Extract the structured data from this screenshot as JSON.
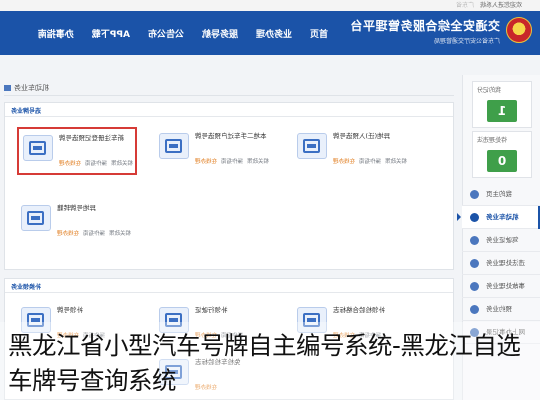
{
  "topbar": {
    "text": "欢迎您进入系统",
    "region": "广东省"
  },
  "header": {
    "brand_title": "交通安全综合服务管理平台",
    "brand_sub": "广东省公安厅交通管理局",
    "nav": [
      "首页",
      "业务办理",
      "服务导航",
      "公告公布",
      "APP下载",
      "办事指南"
    ]
  },
  "sidebar": {
    "cards": [
      {
        "label": "我的记分",
        "value": "1"
      },
      {
        "label": "待处理违法",
        "value": "0"
      }
    ],
    "menu": [
      {
        "label": "我的主页",
        "active": false
      },
      {
        "label": "机动车业务",
        "active": true
      },
      {
        "label": "驾驶证业务",
        "active": false
      },
      {
        "label": "违法处理业务",
        "active": false
      },
      {
        "label": "事故处理业务",
        "active": false
      },
      {
        "label": "预约业务",
        "active": false
      },
      {
        "label": "网上办事记录",
        "active": false
      }
    ]
  },
  "breadcrumb": {
    "label": "机动车业务"
  },
  "panels": [
    {
      "title": "选号牌业务",
      "services": [
        {
          "title": "新车注册登记预选号牌",
          "actions": [
            "在线办理",
            "操作指南",
            "相关政策"
          ],
          "highlight": true
        },
        {
          "title": "本地二手车过户预选号牌",
          "actions": [
            "在线办理",
            "操作指南",
            "相关政策"
          ],
          "highlight": false
        },
        {
          "title": "异地(迁)入预选号牌",
          "actions": [
            "在线办理",
            "操作指南",
            "相关政策"
          ],
          "highlight": false
        },
        {
          "title": "异地号牌转籍",
          "actions": [
            "在线办理",
            "操作指南",
            "相关政策"
          ],
          "highlight": false
        }
      ]
    },
    {
      "title": "补换领业务",
      "services": [
        {
          "title": "补领号牌",
          "actions": [
            "在线办理",
            "操作指南"
          ],
          "highlight": false
        },
        {
          "title": "补领行驶证",
          "actions": [
            "在线办理",
            "操作指南"
          ],
          "highlight": false
        },
        {
          "title": "补领检验合格标志",
          "actions": [
            "在线办理",
            "操作指南"
          ],
          "highlight": false
        },
        {
          "title": "免检车检验标志",
          "actions": [
            "在线办理"
          ],
          "highlight": false
        }
      ]
    }
  ],
  "caption": "黑龙江省小型汽车号牌自主编号系统-黑龙江自选车牌号查询系统",
  "colors": {
    "header_blue": "#1b53a8",
    "counter_green": "#3f9f4a",
    "highlight_red": "#d63b36",
    "apply_orange": "#e07a1a"
  }
}
